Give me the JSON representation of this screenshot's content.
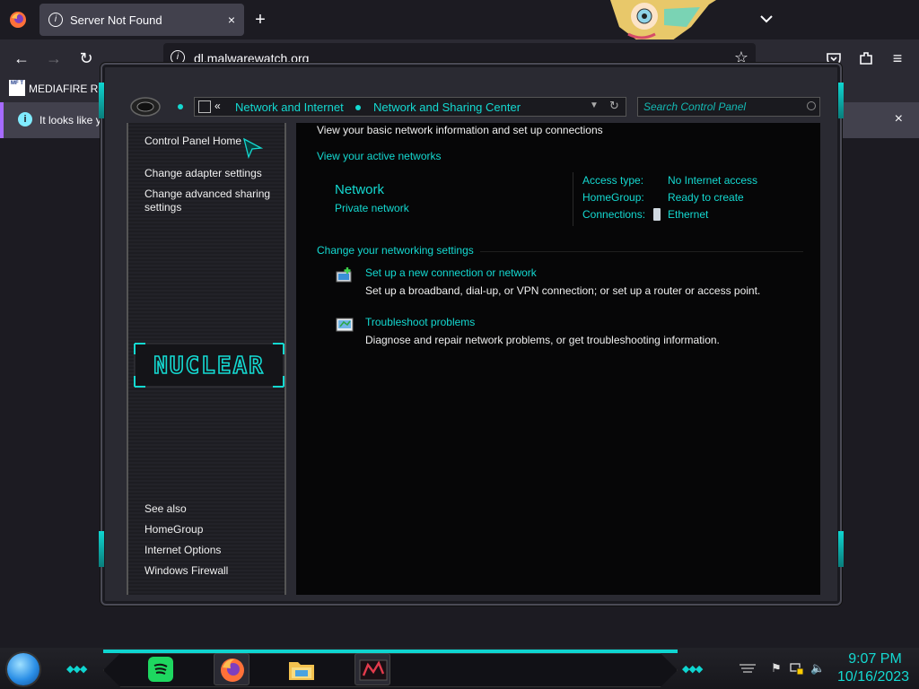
{
  "browser": {
    "tab_title": "Server Not Found",
    "tab_close": "×",
    "new_tab": "+",
    "url": "dl.malwarewatch.org",
    "bookmark": {
      "label": "MEDIAFIRE RO",
      "icon_text": "MF T"
    },
    "infobar_text": "It looks like y",
    "infobar_close": "×",
    "icons": [
      "firefox-logo",
      "info",
      "chevron-down",
      "back-arrow",
      "forward-arrow",
      "reload",
      "star",
      "pocket",
      "extensions",
      "menu"
    ]
  },
  "control_panel": {
    "breadcrumb": {
      "back_symbol": "«",
      "items": [
        "Network and Internet",
        "Network and Sharing Center"
      ]
    },
    "search_placeholder": "Search Control Panel",
    "sidebar": {
      "links": [
        "Control Panel Home",
        "Change adapter settings",
        "Change advanced sharing settings"
      ],
      "logo_text": "NUCLEAR",
      "see_also": "See also",
      "see_also_links": [
        "HomeGroup",
        "Internet Options",
        "Windows Firewall"
      ]
    },
    "main": {
      "title": "View your basic network information and set up connections",
      "active_networks": "View your active networks",
      "network_name": "Network",
      "network_type": "Private network",
      "details": [
        {
          "key": "Access type:",
          "value": "No Internet access"
        },
        {
          "key": "HomeGroup:",
          "value": "Ready to create"
        },
        {
          "key": "Connections:",
          "value": "Ethernet"
        }
      ],
      "change_settings": "Change your networking settings",
      "tasks": [
        {
          "link": "Set up a new connection or network",
          "desc": "Set up a broadband, dial-up, or VPN connection; or set up a router or access point."
        },
        {
          "link": "Troubleshoot problems",
          "desc": "Diagnose and repair network problems, or get troubleshooting information."
        }
      ]
    }
  },
  "taskbar": {
    "apps": [
      "spotify-icon",
      "firefox-icon",
      "file-explorer-icon",
      "control-panel-icon"
    ],
    "clock_time": "9:07 PM",
    "clock_date": "10/16/2023"
  },
  "colors": {
    "accent": "#14d9d1",
    "browser_bg": "#1c1b22",
    "toolbar_bg": "#2b2a33",
    "window_bg": "#060607"
  }
}
